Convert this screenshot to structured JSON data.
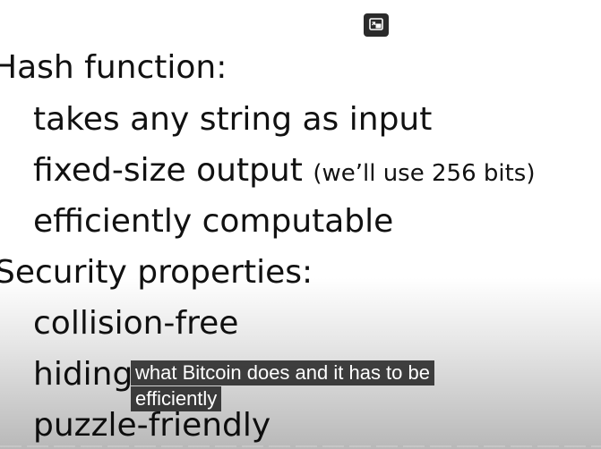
{
  "slide": {
    "heading_1": "Hash function:",
    "bullets_1": [
      {
        "text": "takes any string as input"
      },
      {
        "text": "fixed-size output",
        "note": "(we’ll use 256 bits)"
      },
      {
        "text": "efficiently computable"
      }
    ],
    "heading_2": "Security properties:",
    "bullets_2": [
      {
        "text": "collision-free"
      },
      {
        "text": "hiding"
      },
      {
        "text": "puzzle-friendly"
      }
    ]
  },
  "player": {
    "pip_button_icon": "picture-in-picture-icon",
    "captions": [
      "what Bitcoin does and it has to be",
      "efficiently"
    ]
  }
}
